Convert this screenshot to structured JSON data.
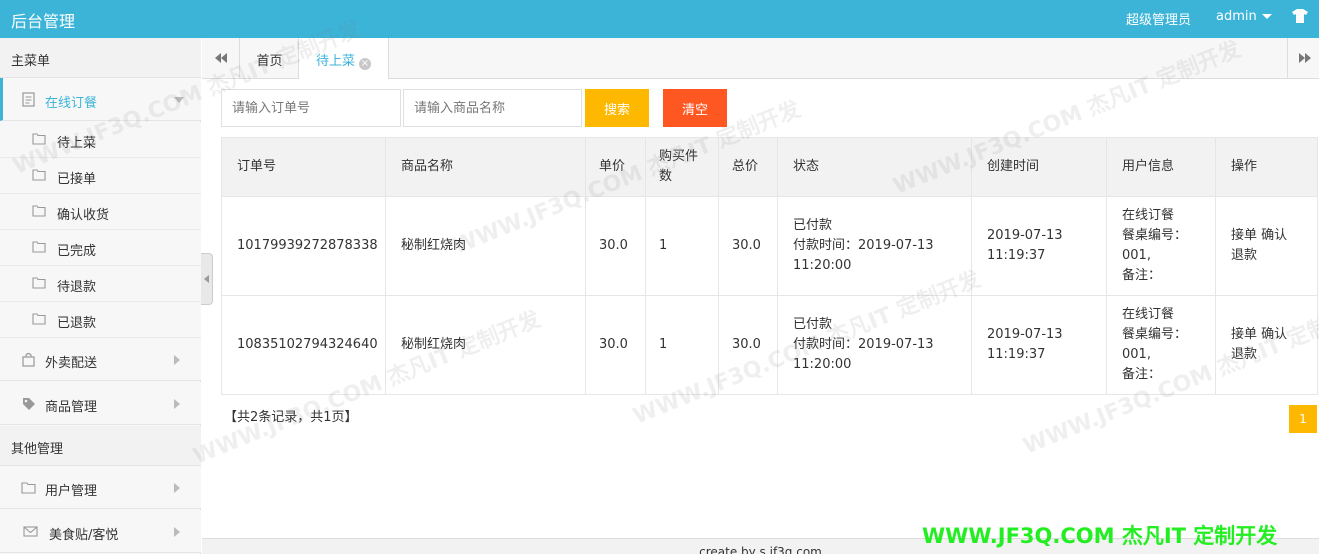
{
  "header": {
    "title": "后台管理",
    "role": "超级管理员",
    "user": "admin"
  },
  "sidebar": {
    "main_section": "主菜单",
    "groups": [
      {
        "label": "在线订餐",
        "expanded": true,
        "children": [
          "待上菜",
          "已接单",
          "确认收货",
          "已完成",
          "待退款",
          "已退款"
        ]
      },
      {
        "label": "外卖配送",
        "expanded": false
      },
      {
        "label": "商品管理",
        "expanded": false
      }
    ],
    "other_section": "其他管理",
    "other_items": [
      "用户管理",
      "美食贴/客悦"
    ]
  },
  "tabs": [
    {
      "label": "首页",
      "active": false
    },
    {
      "label": "待上菜",
      "active": true,
      "closable": true
    }
  ],
  "toolbar": {
    "order_placeholder": "请输入订单号",
    "product_placeholder": "请输入商品名称",
    "search_label": "搜索",
    "clear_label": "清空"
  },
  "table": {
    "columns": [
      "订单号",
      "商品名称",
      "单价",
      "购买件数",
      "总价",
      "状态",
      "创建时间",
      "用户信息",
      "操作"
    ],
    "rows": [
      {
        "order_no": "10179939272878338",
        "product": "秘制红烧肉",
        "price": "30.0",
        "qty": "1",
        "total": "30.0",
        "status_line1": "已付款",
        "status_line2": "付款时间：2019-07-13",
        "status_line3": "11:20:00",
        "created_date": "2019-07-13",
        "created_time": "11:19:37",
        "user_line1": "在线订餐",
        "user_line2": "餐桌编号：",
        "user_line3": "001,",
        "user_line4": "备注：",
        "action_accept": "接单",
        "action_confirm": "确认",
        "action_refund": "退款"
      },
      {
        "order_no": "10835102794324640",
        "product": "秘制红烧肉",
        "price": "30.0",
        "qty": "1",
        "total": "30.0",
        "status_line1": "已付款",
        "status_line2": "付款时间：2019-07-13",
        "status_line3": "11:20:00",
        "created_date": "2019-07-13",
        "created_time": "11:19:37",
        "user_line1": "在线订餐",
        "user_line2": "餐桌编号：",
        "user_line3": "001,",
        "user_line4": "备注：",
        "action_accept": "接单",
        "action_confirm": "确认",
        "action_refund": "退款"
      }
    ]
  },
  "pagination": {
    "summary": "【共2条记录，共1页】",
    "current_page": "1"
  },
  "footer": {
    "text": "create by s.jf3q.com"
  },
  "watermark": {
    "text": "WWW.JF3Q.COM 杰凡IT  定制开发"
  },
  "colors": {
    "header_bg": "#3bb4d8",
    "accent": "#3bb4d8",
    "search_btn": "#ffb800",
    "clear_btn": "#ff5722",
    "page_active": "#ffb800",
    "banner_green": "#22ee22"
  }
}
